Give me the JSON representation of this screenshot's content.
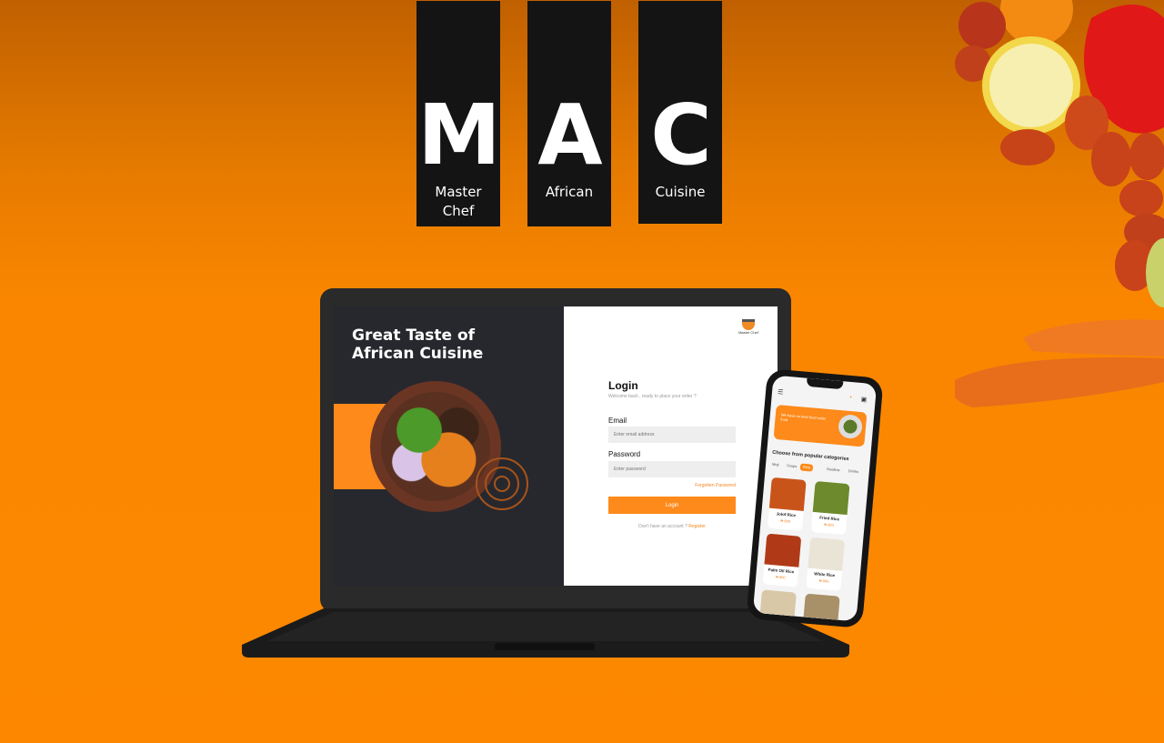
{
  "brand": {
    "tiles": [
      {
        "letter": "M",
        "word": "Master Chef"
      },
      {
        "letter": "A",
        "word": "African"
      },
      {
        "letter": "C",
        "word": "Cuisine"
      }
    ]
  },
  "laptop": {
    "hero_title": "Great Taste of African Cuisine",
    "logo_text": "Master Chef",
    "login": {
      "title": "Login",
      "subtitle": "Welcome back , ready to place your order ?",
      "email_label": "Email",
      "email_placeholder": "Enter email address",
      "password_label": "Password",
      "password_placeholder": "Enter password",
      "forgot_link": "Forgotten Password",
      "button_label": "Login",
      "register_prompt": "Don't have an account ?",
      "register_link": "Register"
    }
  },
  "phone": {
    "promo_text": "We have no best food order food",
    "categories_title": "Choose from popular categories",
    "categories": [
      "Mojt",
      "Soups",
      "Rice",
      "Swallow",
      "Drinks"
    ],
    "active_category": "Rice",
    "items": [
      {
        "name": "Jolof Rice",
        "price": "₦ 800",
        "color": "#c9541a"
      },
      {
        "name": "Fried Rice",
        "price": "₦ 800",
        "color": "#6d8a2c"
      },
      {
        "name": "Palm Oil Rice",
        "price": "₦ 800",
        "color": "#b03a18"
      },
      {
        "name": "White Rice",
        "price": "₦ 800",
        "color": "#e9e4d6"
      }
    ]
  },
  "colors": {
    "accent": "#fd8a1a",
    "background": "#fd8800",
    "tile": "#141414"
  }
}
